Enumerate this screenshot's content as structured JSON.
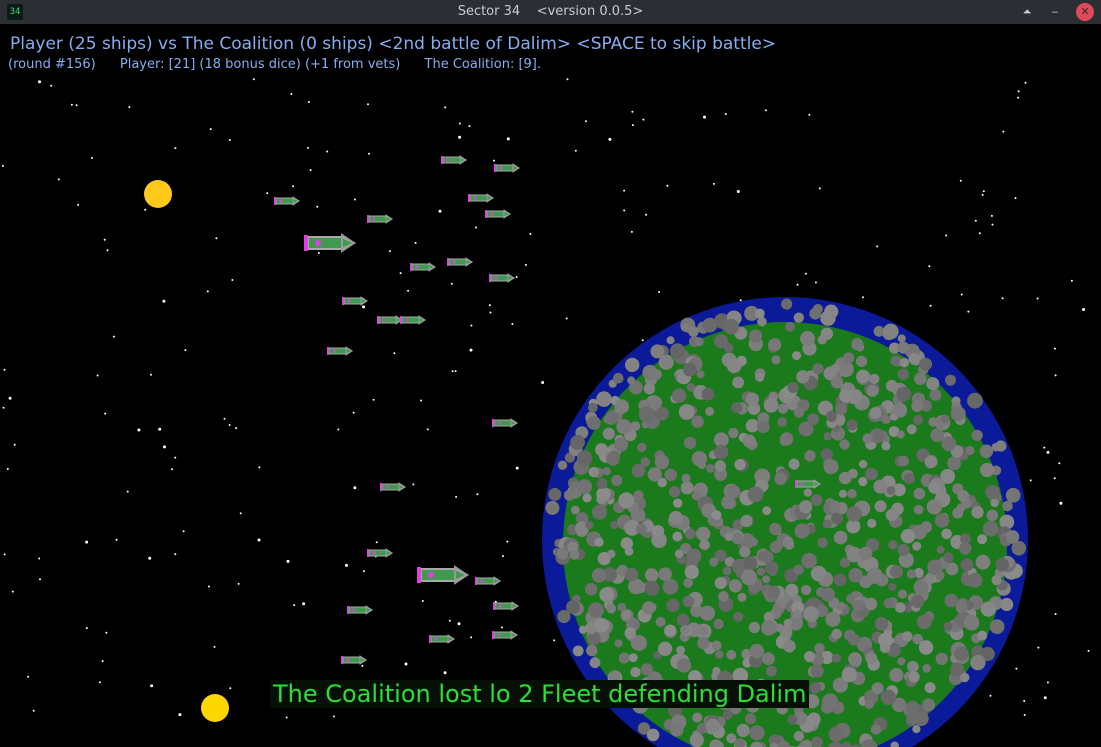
{
  "window": {
    "icon_text": "34",
    "title": "Sector 34",
    "version": "<version 0.0.5>"
  },
  "hud": {
    "headline": "Player (25 ships) vs The Coalition (0 ships) <2nd battle of Dalim> <SPACE to skip battle>",
    "round": "(round #156)",
    "player_stats": "Player: [21] (18 bonus dice) (+1 from vets)",
    "enemy_stats": "The Coalition: [9]."
  },
  "message": "The Coalition lost lo 2 Fleet defending Dalim",
  "colors": {
    "hud_text": "#86aef0",
    "message_text": "#2be034",
    "ship_body": "#3f9a4f",
    "ship_outline": "#a8a8a8",
    "ship_accent": "#e040e0",
    "sun": "#ffd700",
    "planet_ocean": "#0b1a99",
    "planet_land": "#1b7a1b",
    "planet_cloud": "#7a7a7a"
  },
  "ships": {
    "player": 25,
    "enemy": 0
  }
}
